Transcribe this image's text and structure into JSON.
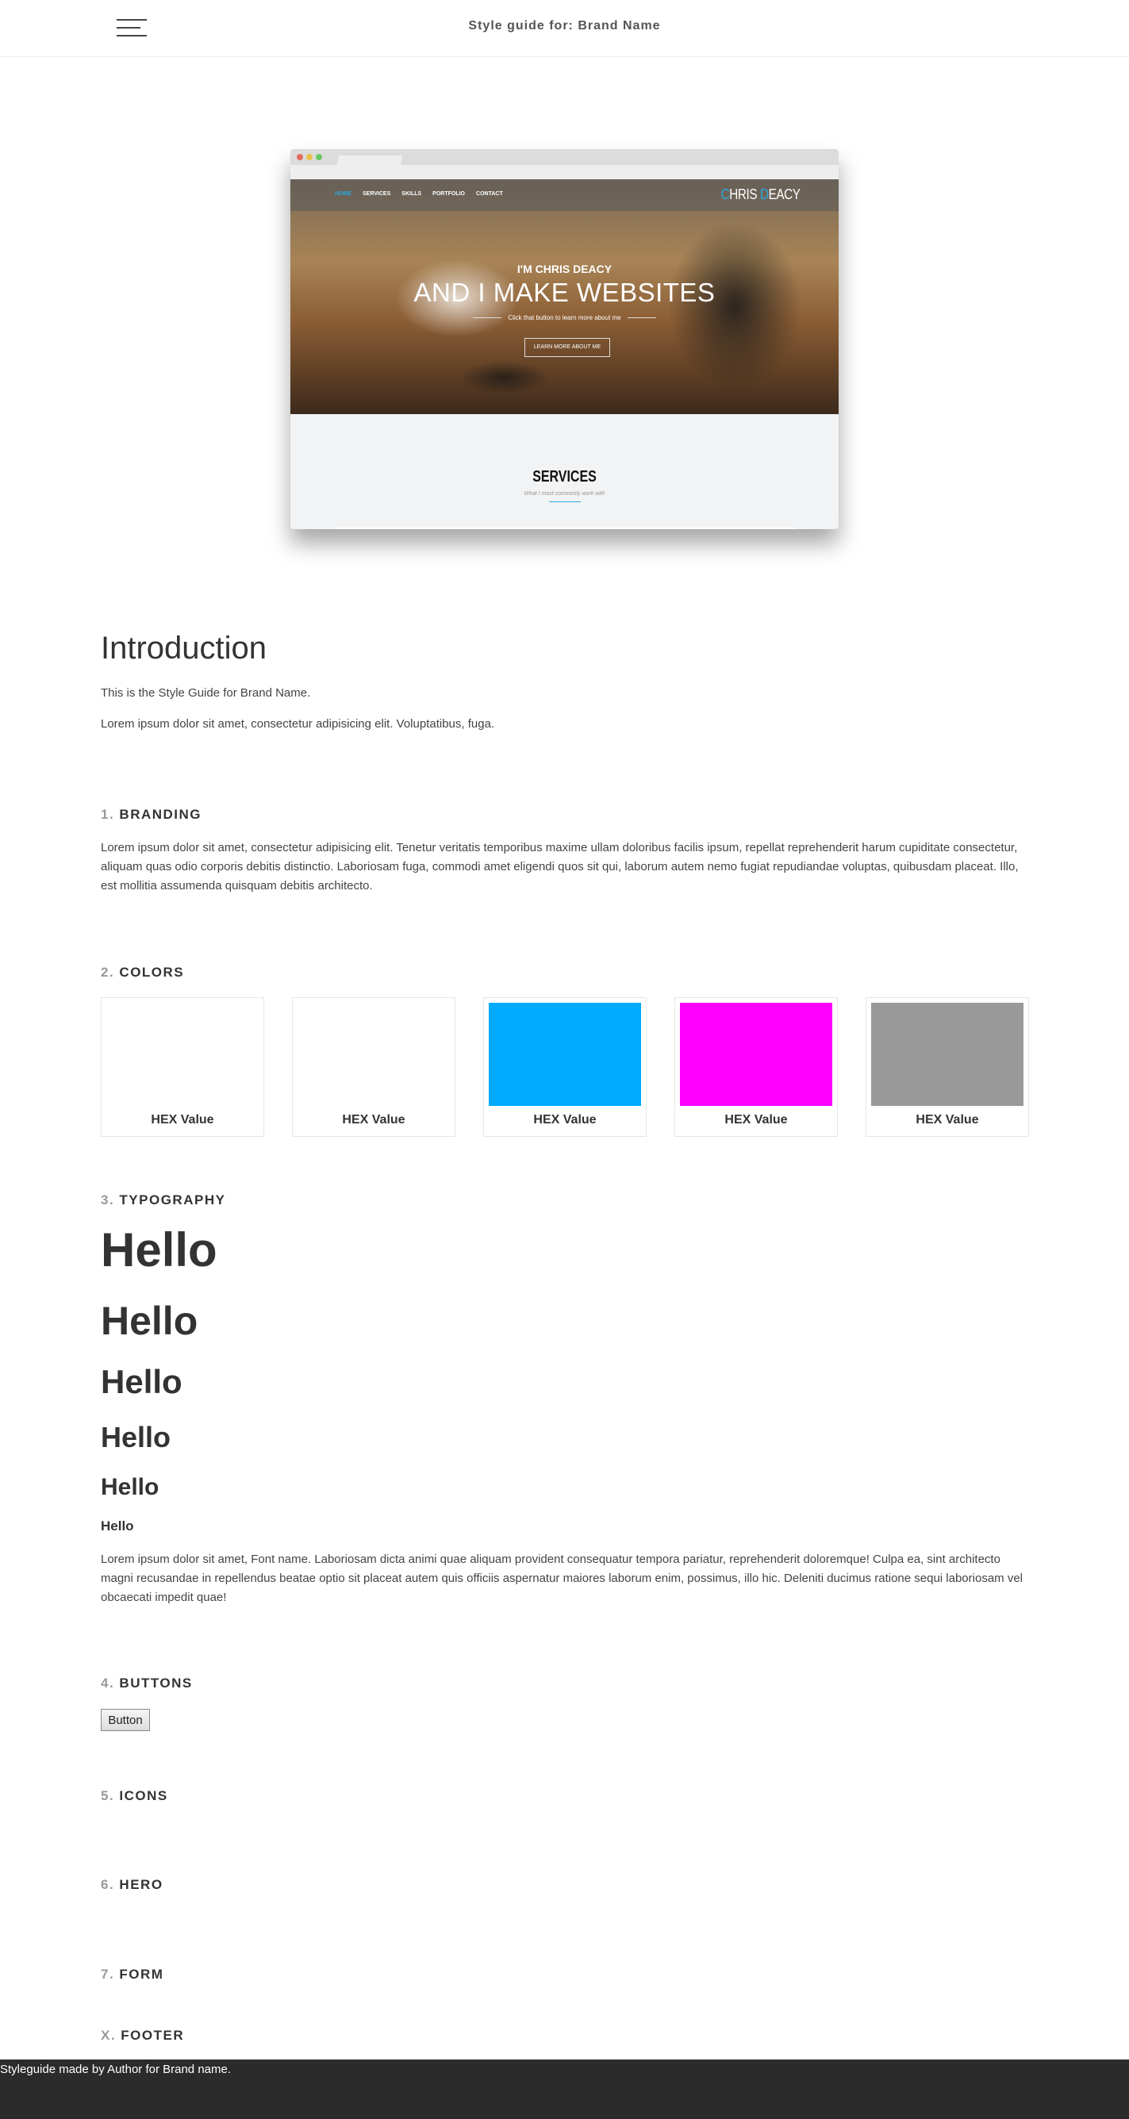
{
  "header": {
    "title": "Style guide for: Brand Name",
    "menu_icon": "hamburger-menu-icon"
  },
  "mockup": {
    "nav": [
      "HOME",
      "SERVICES",
      "SKILLS",
      "PORTFOLIO",
      "CONTACT"
    ],
    "logo_first": "C",
    "logo_rest": "HRIS ",
    "logo_d": "D",
    "logo_end": "EACY",
    "hero_sub": "I'M CHRIS DEACY",
    "hero_title": "AND I MAKE WEBSITES",
    "hero_line": "Click that button to learn more about me",
    "hero_button": "LEARN MORE ABOUT ME",
    "services_title": "SERVICES",
    "services_sub": "What I most commonly work with"
  },
  "intro": {
    "title": "Introduction",
    "line1": "This is the Style Guide for Brand Name.",
    "line2": "Lorem ipsum dolor sit amet, consectetur adipisicing elit. Voluptatibus, fuga."
  },
  "sections": {
    "branding": {
      "num": "1.",
      "title": "BRANDING",
      "text": "Lorem ipsum dolor sit amet, consectetur adipisicing elit. Tenetur veritatis temporibus maxime ullam doloribus facilis ipsum, repellat reprehenderit harum cupiditate consectetur, aliquam quas odio corporis debitis distinctio. Laboriosam fuga, commodi amet eligendi quos sit qui, laborum autem nemo fugiat repudiandae voluptas, quibusdam placeat. Illo, est mollitia assumenda quisquam debitis architecto."
    },
    "colors": {
      "num": "2.",
      "title": "COLORS"
    },
    "typography": {
      "num": "3.",
      "title": "TYPOGRAPHY"
    },
    "buttons": {
      "num": "4.",
      "title": "BUTTONS",
      "button_label": "Button"
    },
    "icons": {
      "num": "5.",
      "title": "ICONS"
    },
    "hero": {
      "num": "6.",
      "title": "HERO"
    },
    "form": {
      "num": "7.",
      "title": "FORM"
    },
    "footer": {
      "num": "X.",
      "title": "FOOTER"
    }
  },
  "colors": [
    {
      "label": "HEX Value",
      "color": "#ffffff"
    },
    {
      "label": "HEX Value",
      "color": "#ffffff"
    },
    {
      "label": "HEX Value",
      "color": "#00aaff"
    },
    {
      "label": "HEX Value",
      "color": "#ff00ff"
    },
    {
      "label": "HEX Value",
      "color": "#999999"
    }
  ],
  "typography": {
    "h1": "Hello",
    "h2": "Hello",
    "h3": "Hello",
    "h4": "Hello",
    "h5": "Hello",
    "h6": "Hello",
    "body": "Lorem ipsum dolor sit amet, Font name. Laboriosam dicta animi quae aliquam provident consequatur tempora pariatur, reprehenderit doloremque! Culpa ea, sint architecto magni recusandae in repellendus beatae optio sit placeat autem quis officiis aspernatur maiores laborum enim, possimus, illo hic. Deleniti ducimus ratione sequi laboriosam vel obcaecati impedit quae!"
  },
  "footer": {
    "text": "Styleguide made by Author for Brand name."
  }
}
